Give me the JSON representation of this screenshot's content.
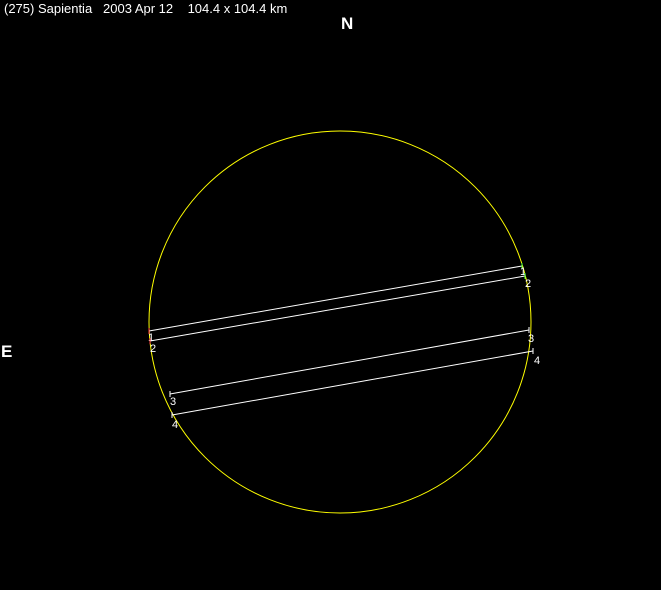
{
  "header": {
    "title": "(275) Sapientia   2003 Apr 12    104.4 x 104.4 km"
  },
  "directions": {
    "north": "N",
    "east": "E"
  },
  "colors": {
    "background": "#000000",
    "ellipse": "#ffff00",
    "chord": "#ffffff",
    "east_marker": "#ff4040",
    "west_marker": "#40ff40"
  },
  "chords": [
    {
      "id": "1",
      "label_start": "1",
      "label_end": "1"
    },
    {
      "id": "2",
      "label_start": "2",
      "label_end": "2"
    },
    {
      "id": "3",
      "label_start": "3",
      "label_end": "3"
    },
    {
      "id": "4",
      "label_start": "4",
      "label_end": "4"
    }
  ]
}
